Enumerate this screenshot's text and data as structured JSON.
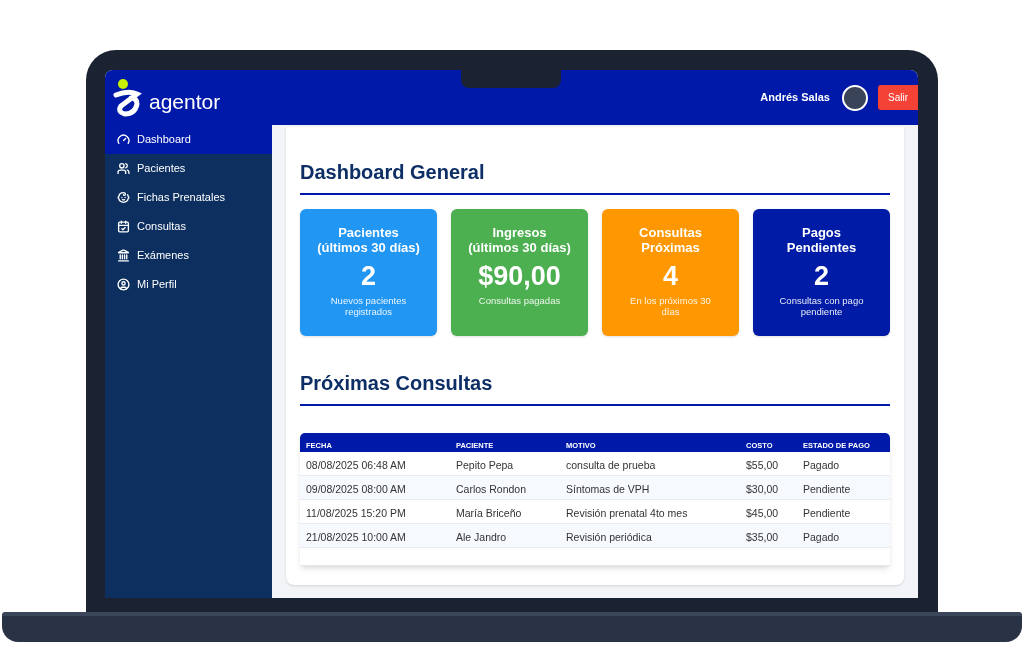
{
  "header": {
    "logo": "agentor",
    "user_name": "Andrés Salas",
    "logout_button": "Salir"
  },
  "sidebar": {
    "items": [
      {
        "label": "Dashboard",
        "selected": true
      },
      {
        "label": "Pacientes",
        "selected": false
      },
      {
        "label": "Fichas Prenatales",
        "selected": false
      },
      {
        "label": "Consultas",
        "selected": false
      },
      {
        "label": "Exámenes",
        "selected": false
      },
      {
        "label": "Mi Perfil",
        "selected": false
      }
    ]
  },
  "page_title": "Dashboard General",
  "stat_cards": [
    {
      "title": "Pacientes\n(últimos 30 días)",
      "value": "2",
      "caption": "Nuevos pacientes registrados",
      "color": "#2196f3"
    },
    {
      "title": "Ingresos\n(últimos 30 días)",
      "value": "$90,00",
      "caption": "Consultas pagadas",
      "color": "#4caf50"
    },
    {
      "title": "Consultas\nPróximas",
      "value": "4",
      "caption": "En los próximos 30 días",
      "color": "#ff9800"
    },
    {
      "title": "Pagos\nPendientes",
      "value": "2",
      "caption": "Consultas con pago pendiente",
      "color": "#001ba5"
    }
  ],
  "section_title": "Próximas Consultas",
  "table": {
    "columns": [
      "FECHA",
      "PACIENTE",
      "MOTIVO",
      "COSTO",
      "ESTADO DE PAGO"
    ],
    "rows": [
      [
        "08/08/2025 06:48 AM",
        "Pepito Pepa",
        "consulta de prueba",
        "$55,00",
        "Pagado"
      ],
      [
        "09/08/2025 08:00 AM",
        "Carlos Rondon",
        "Síntomas de VPH",
        "$30,00",
        "Pendiente"
      ],
      [
        "11/08/2025 15:20 PM",
        "María Briceño",
        "Revisión prenatal 4to mes",
        "$45,00",
        "Pendiente"
      ],
      [
        "21/08/2025 10:00 AM",
        "Ale Jandro",
        "Revisión periódica",
        "$35,00",
        "Pagado"
      ]
    ]
  }
}
